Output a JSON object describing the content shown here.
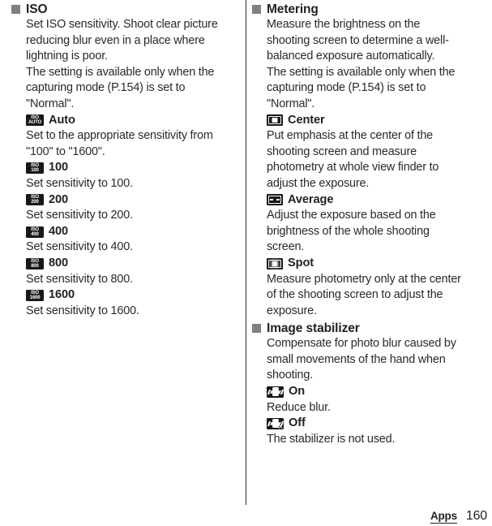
{
  "page": {
    "number": "160",
    "section_label": "Apps"
  },
  "left_column": {
    "heading": "ISO",
    "intro": [
      "Set ISO sensitivity. Shoot clear picture reducing blur even in a place where lightning is poor.",
      "The setting is available only when the capturing mode (P.154) is set to \"Normal\"."
    ],
    "options": [
      {
        "icon": "iso-auto-icon",
        "icon_line1": "ISO",
        "icon_line2": "AUTO",
        "label": "Auto",
        "description": "Set to the appropriate sensitivity from \"100\" to \"1600\"."
      },
      {
        "icon": "iso-100-icon",
        "icon_line1": "ISO",
        "icon_line2": "100",
        "label": "100",
        "description": "Set sensitivity to 100."
      },
      {
        "icon": "iso-200-icon",
        "icon_line1": "ISO",
        "icon_line2": "200",
        "label": "200",
        "description": "Set sensitivity to 200."
      },
      {
        "icon": "iso-400-icon",
        "icon_line1": "ISO",
        "icon_line2": "400",
        "label": "400",
        "description": "Set sensitivity to 400."
      },
      {
        "icon": "iso-800-icon",
        "icon_line1": "ISO",
        "icon_line2": "800",
        "label": "800",
        "description": "Set sensitivity to 800."
      },
      {
        "icon": "iso-1600-icon",
        "icon_line1": "ISO",
        "icon_line2": "1600",
        "label": "1600",
        "description": "Set sensitivity to 1600."
      }
    ]
  },
  "right_column": {
    "sections": [
      {
        "heading": "Metering",
        "intro": [
          "Measure the brightness on the shooting screen to determine a well-balanced exposure automatically.",
          "The setting is available only when the capturing mode (P.154) is set to \"Normal\"."
        ],
        "options": [
          {
            "icon": "metering-center-icon",
            "label": "Center",
            "description": "Put emphasis at the center of the shooting screen and measure photometry at whole view finder to adjust the exposure."
          },
          {
            "icon": "metering-average-icon",
            "label": "Average",
            "description": "Adjust the exposure based on the brightness of the whole shooting screen."
          },
          {
            "icon": "metering-spot-icon",
            "label": "Spot",
            "description": "Measure photometry only at the center of the shooting screen to adjust the exposure."
          }
        ]
      },
      {
        "heading": "Image stabilizer",
        "intro": [
          "Compensate for photo blur caused by small movements of the hand when shooting."
        ],
        "options": [
          {
            "icon": "stabilizer-on-icon",
            "label": "On",
            "description": "Reduce blur."
          },
          {
            "icon": "stabilizer-off-icon",
            "label": "Off",
            "description": "The stabilizer is not used."
          }
        ]
      }
    ]
  },
  "colors": {
    "bullet": "#808080",
    "text": "#231f20",
    "icon_background": "#1b1718",
    "divider": "#2c2a2b"
  }
}
